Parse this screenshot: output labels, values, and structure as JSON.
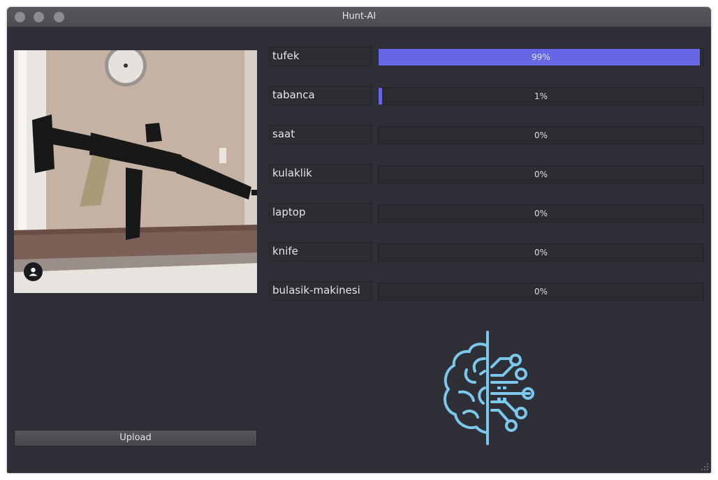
{
  "window": {
    "title": "Hunt-AI"
  },
  "left_panel": {
    "upload_label": "Upload"
  },
  "predictions": [
    {
      "label": "tufek",
      "value": 0.99,
      "text": "99%"
    },
    {
      "label": "tabanca",
      "value": 0.01,
      "text": "1%"
    },
    {
      "label": "saat",
      "value": 0.0,
      "text": "0%"
    },
    {
      "label": "kulaklik",
      "value": 0.0,
      "text": "0%"
    },
    {
      "label": "laptop",
      "value": 0.0,
      "text": "0%"
    },
    {
      "label": "knife",
      "value": 0.0,
      "text": "0%"
    },
    {
      "label": "bulasik-makinesi",
      "value": 0.0,
      "text": "0%"
    }
  ],
  "colors": {
    "accent": "#6767e6",
    "brain": "#7cc7ec",
    "background": "#2f2f37"
  },
  "icons": {
    "photo_badge": "user-icon",
    "logo": "brain-circuit-icon"
  }
}
